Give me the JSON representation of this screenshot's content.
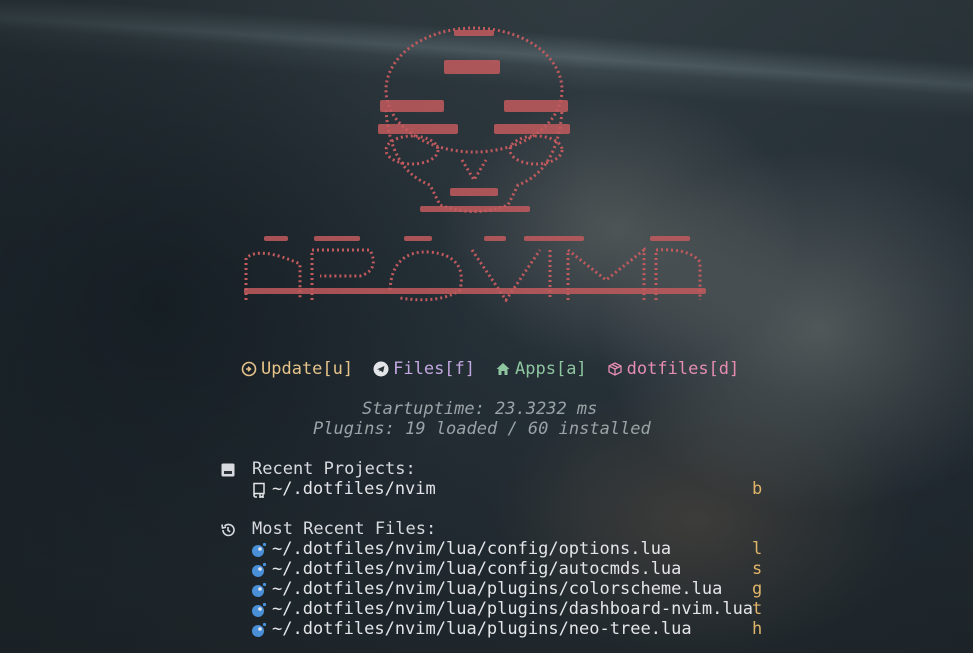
{
  "colors": {
    "logo": "#c25a5e",
    "update": "#e6c38a",
    "files": "#c3a7e0",
    "apps": "#8ec6a0",
    "dotfiles": "#e58db0",
    "stats": "#9aa3a6",
    "text": "#e3e5e8",
    "key": "#e0b56a",
    "lua_icon": "#4a90d9"
  },
  "logo": {
    "icon": "skull-ascii-art",
    "wordmark_icon": "neovim-ascii-wordmark"
  },
  "actions": [
    {
      "icon": "refresh-icon",
      "label": "Update[u]"
    },
    {
      "icon": "telegram-plane-icon",
      "label": "Files[f]"
    },
    {
      "icon": "home-icon",
      "label": "Apps[a]"
    },
    {
      "icon": "package-icon",
      "label": "dotfiles[d]"
    }
  ],
  "stats": {
    "startup": "Startuptime: 23.3232 ms",
    "plugins": "Plugins: 19 loaded / 60 installed"
  },
  "projects": {
    "title": "Recent Projects:",
    "icon": "folder-icon",
    "items": [
      {
        "icon": "repo-icon",
        "path": "~/.dotfiles/nvim",
        "key": "b"
      }
    ]
  },
  "mru": {
    "title": "Most Recent Files:",
    "icon": "history-icon",
    "items": [
      {
        "icon": "lua-icon",
        "path": "~/.dotfiles/nvim/lua/config/options.lua",
        "key": "l"
      },
      {
        "icon": "lua-icon",
        "path": "~/.dotfiles/nvim/lua/config/autocmds.lua",
        "key": "s"
      },
      {
        "icon": "lua-icon",
        "path": "~/.dotfiles/nvim/lua/plugins/colorscheme.lua",
        "key": "g"
      },
      {
        "icon": "lua-icon",
        "path": "~/.dotfiles/nvim/lua/plugins/dashboard-nvim.lua",
        "key": "t"
      },
      {
        "icon": "lua-icon",
        "path": "~/.dotfiles/nvim/lua/plugins/neo-tree.lua",
        "key": "h"
      }
    ]
  }
}
